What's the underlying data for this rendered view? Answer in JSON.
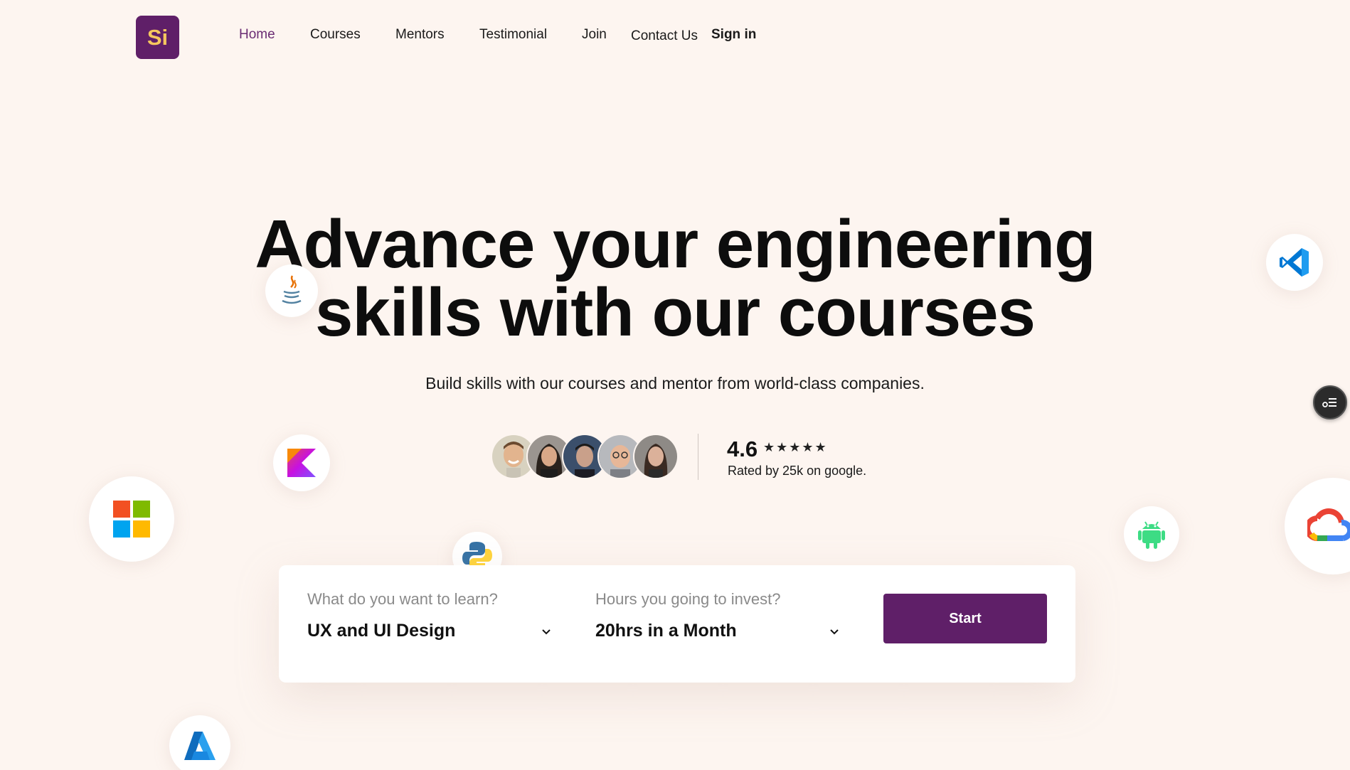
{
  "brand": {
    "logo_text": "Si",
    "logo_bg": "#5f1f68",
    "logo_fg": "#f5c75e"
  },
  "nav": {
    "items": [
      {
        "label": "Home",
        "active": true
      },
      {
        "label": "Courses"
      },
      {
        "label": "Mentors"
      },
      {
        "label": "Testimonial"
      },
      {
        "label": "Join"
      },
      {
        "label": "Contact Us"
      }
    ],
    "sign_in": "Sign in"
  },
  "hero": {
    "title_line1": "Advance your engineering",
    "title_line2": "skills with our courses",
    "subtitle": "Build skills with our courses and mentor from world-class companies."
  },
  "rating": {
    "value": "4.6",
    "stars": "★★★★★",
    "stars_count": 4.6,
    "text": "Rated by 25k on google."
  },
  "floating_icons": [
    "java-icon",
    "kotlin-icon",
    "microsoft-icon",
    "python-icon",
    "azure-icon",
    "vscode-icon",
    "android-icon",
    "google-cloud-icon"
  ],
  "search": {
    "learn_label": "What do you want to learn?",
    "learn_value": "UX and UI Design",
    "hours_label": "Hours you going to invest?",
    "hours_value": "20hrs in a Month",
    "start_label": "Start"
  },
  "colors": {
    "accent": "#5f1f68",
    "background": "#fdf5f0",
    "active_nav": "#6a2c73"
  }
}
